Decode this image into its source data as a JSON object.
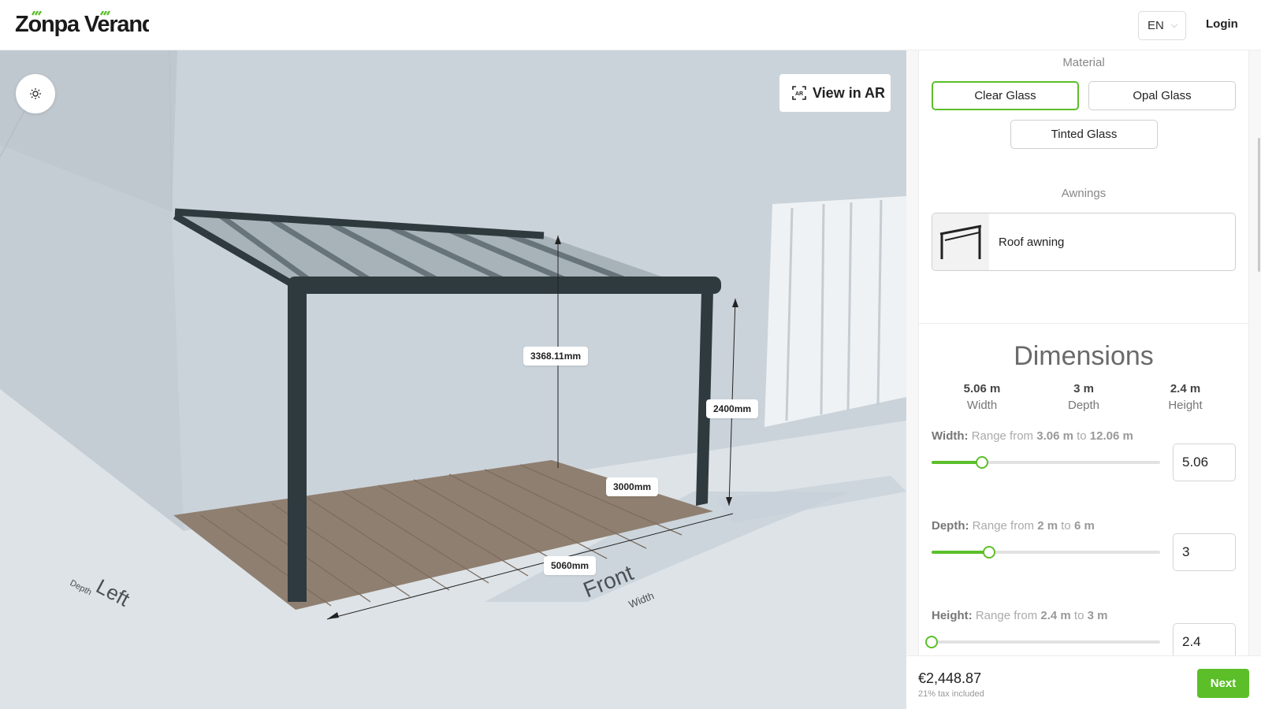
{
  "header": {
    "logo_text": "Zonpa Veranda",
    "language": "EN",
    "login_label": "Login"
  },
  "viewport": {
    "view_in_ar_label": "View in AR",
    "measurements": {
      "roof_height": "3368.11mm",
      "post_height": "2400mm",
      "depth": "3000mm",
      "width": "5060mm"
    },
    "floor_labels": {
      "left": "Left",
      "left_sub": "Depth",
      "front": "Front",
      "front_sub": "Width"
    }
  },
  "material": {
    "title": "Material",
    "options": [
      "Clear Glass",
      "Opal Glass",
      "Tinted Glass"
    ],
    "selected": "Clear Glass"
  },
  "awnings": {
    "title": "Awnings",
    "options": [
      "Roof awning"
    ]
  },
  "dimensions": {
    "title": "Dimensions",
    "summary": [
      {
        "value": "5.06 m",
        "caption": "Width"
      },
      {
        "value": "3 m",
        "caption": "Depth"
      },
      {
        "value": "2.4 m",
        "caption": "Height"
      }
    ],
    "width": {
      "key": "Width:",
      "prefix": "Range from",
      "min": "3.06 m",
      "mid": "to",
      "max": "12.06 m",
      "value": "5.06",
      "fraction": 0.222
    },
    "depth": {
      "key": "Depth:",
      "prefix": "Range from",
      "min": "2 m",
      "mid": "to",
      "max": "6 m",
      "value": "3",
      "fraction": 0.25
    },
    "height": {
      "key": "Height:",
      "prefix": "Range from",
      "min": "2.4 m",
      "mid": "to",
      "max": "3 m",
      "value": "2.4",
      "fraction": 0.0
    }
  },
  "footer": {
    "price": "€2,448.87",
    "tax_note": "21% tax included",
    "next_label": "Next"
  },
  "colors": {
    "accent": "#5cbf2a",
    "frame": "#2f3a3e"
  }
}
